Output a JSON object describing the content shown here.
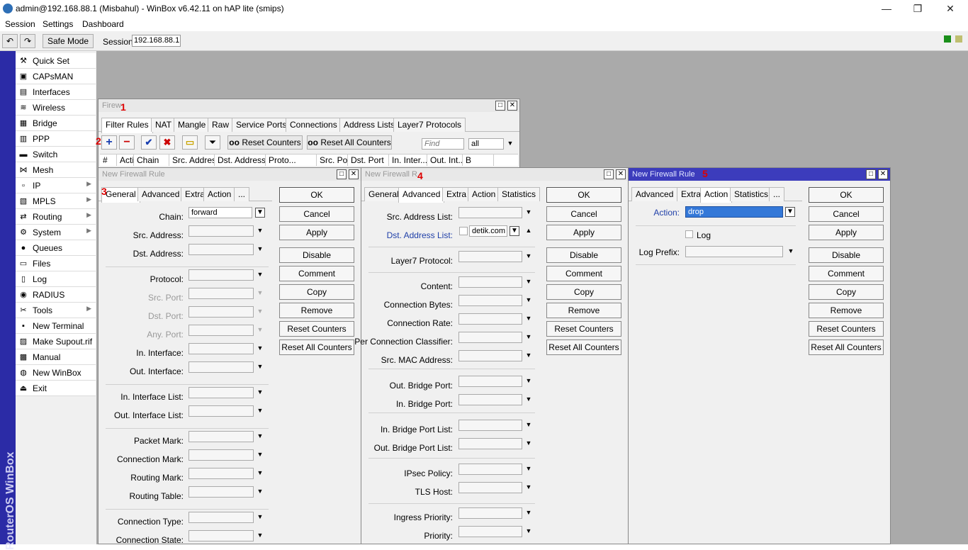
{
  "titlebar": {
    "title": "admin@192.168.88.1 (Misbahul) - WinBox v6.42.11 on hAP lite (smips)",
    "minimize": "—",
    "maximize": "❐",
    "close": "✕"
  },
  "menu": {
    "session": "Session",
    "settings": "Settings",
    "dashboard": "Dashboard"
  },
  "toolbar": {
    "undo": "↶",
    "redo": "↷",
    "safe_mode": "Safe Mode",
    "session_label": "Session:",
    "session_value": "192.168.88.1"
  },
  "sidebar": {
    "brand": "RouterOS WinBox",
    "items": [
      {
        "label": "Quick Set",
        "icon": "⚒"
      },
      {
        "label": "CAPsMAN",
        "icon": "▣"
      },
      {
        "label": "Interfaces",
        "icon": "▤"
      },
      {
        "label": "Wireless",
        "icon": "≋"
      },
      {
        "label": "Bridge",
        "icon": "▦"
      },
      {
        "label": "PPP",
        "icon": "▥"
      },
      {
        "label": "Switch",
        "icon": "▬"
      },
      {
        "label": "Mesh",
        "icon": "⋈"
      },
      {
        "label": "IP",
        "icon": "▫"
      },
      {
        "label": "MPLS",
        "icon": "▧"
      },
      {
        "label": "Routing",
        "icon": "⇄"
      },
      {
        "label": "System",
        "icon": "⚙"
      },
      {
        "label": "Queues",
        "icon": "●"
      },
      {
        "label": "Files",
        "icon": "▭"
      },
      {
        "label": "Log",
        "icon": "▯"
      },
      {
        "label": "RADIUS",
        "icon": "◉"
      },
      {
        "label": "Tools",
        "icon": "✂"
      },
      {
        "label": "New Terminal",
        "icon": "▪"
      },
      {
        "label": "Make Supout.rif",
        "icon": "▨"
      },
      {
        "label": "Manual",
        "icon": "▩"
      },
      {
        "label": "New WinBox",
        "icon": "◍"
      },
      {
        "label": "Exit",
        "icon": "⏏"
      }
    ]
  },
  "firewall": {
    "title": "Firew",
    "marker": "1",
    "tabs": [
      "Filter Rules",
      "NAT",
      "Mangle",
      "Raw",
      "Service Ports",
      "Connections",
      "Address Lists",
      "Layer7 Protocols"
    ],
    "marker2": "2",
    "reset_counters": "Reset Counters",
    "reset_all_counters": "Reset All Counters",
    "oo": "oo",
    "find_placeholder": "Find",
    "filter_value": "all",
    "columns": [
      "#",
      "Action",
      "Chain",
      "Src. Address",
      "Dst. Address",
      "Proto...",
      "Src. Port",
      "Dst. Port",
      "In. Inter...",
      "Out. Int...",
      "B"
    ]
  },
  "win3": {
    "title": "New Firewall Rule",
    "marker": "3",
    "tabs": [
      "General",
      "Advanced",
      "Extra",
      "Action",
      "..."
    ],
    "fields": [
      {
        "label": "Chain:",
        "value": "forward"
      },
      {
        "label": "Src. Address:",
        "value": ""
      },
      {
        "label": "Dst. Address:",
        "value": ""
      },
      {
        "label": "Protocol:",
        "value": ""
      },
      {
        "label": "Src. Port:",
        "value": ""
      },
      {
        "label": "Dst. Port:",
        "value": ""
      },
      {
        "label": "Any. Port:",
        "value": ""
      },
      {
        "label": "In. Interface:",
        "value": ""
      },
      {
        "label": "Out. Interface:",
        "value": ""
      },
      {
        "label": "In. Interface List:",
        "value": ""
      },
      {
        "label": "Out. Interface List:",
        "value": ""
      },
      {
        "label": "Packet Mark:",
        "value": ""
      },
      {
        "label": "Connection Mark:",
        "value": ""
      },
      {
        "label": "Routing Mark:",
        "value": ""
      },
      {
        "label": "Routing Table:",
        "value": ""
      },
      {
        "label": "Connection Type:",
        "value": ""
      },
      {
        "label": "Connection State:",
        "value": ""
      }
    ]
  },
  "win4": {
    "title": "New Firewall R",
    "marker": "4",
    "tabs": [
      "General",
      "Advanced",
      "Extra",
      "Action",
      "Statistics"
    ],
    "fields": [
      {
        "label": "Src. Address List:",
        "value": ""
      },
      {
        "label": "Dst. Address List:",
        "value": "detik.com"
      },
      {
        "label": "Layer7 Protocol:",
        "value": ""
      },
      {
        "label": "Content:",
        "value": ""
      },
      {
        "label": "Connection Bytes:",
        "value": ""
      },
      {
        "label": "Connection Rate:",
        "value": ""
      },
      {
        "label": "Per Connection Classifier:",
        "value": ""
      },
      {
        "label": "Src. MAC Address:",
        "value": ""
      },
      {
        "label": "Out. Bridge Port:",
        "value": ""
      },
      {
        "label": "In. Bridge Port:",
        "value": ""
      },
      {
        "label": "In. Bridge Port List:",
        "value": ""
      },
      {
        "label": "Out. Bridge Port List:",
        "value": ""
      },
      {
        "label": "IPsec Policy:",
        "value": ""
      },
      {
        "label": "TLS Host:",
        "value": ""
      },
      {
        "label": "Ingress Priority:",
        "value": ""
      },
      {
        "label": "Priority:",
        "value": ""
      }
    ]
  },
  "win5": {
    "title": "New Firewall Rule",
    "marker": "5",
    "tabs": [
      "Advanced",
      "Extra",
      "Action",
      "Statistics",
      "..."
    ],
    "action_label": "Action:",
    "action_value": "drop",
    "log_label": "Log",
    "log_prefix_label": "Log Prefix:",
    "log_prefix_value": ""
  },
  "buttons": [
    "OK",
    "Cancel",
    "Apply",
    "Disable",
    "Comment",
    "Copy",
    "Remove",
    "Reset Counters",
    "Reset All Counters"
  ]
}
